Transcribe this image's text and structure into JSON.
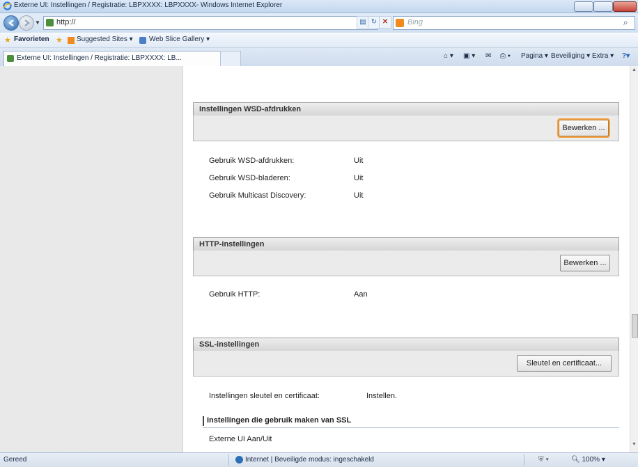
{
  "window": {
    "title": "Externe UI: Instellingen / Registratie: LBPXXXX: LBPXXXX- Windows Internet Explorer"
  },
  "address_bar": {
    "url": "http://",
    "search_placeholder": "Bing"
  },
  "favorites_bar": {
    "favorites_label": "Favorieten",
    "items": [
      "Suggested Sites ▾",
      "Web Slice Gallery ▾"
    ]
  },
  "tab": {
    "label": "Externe UI: Instellingen / Registratie: LBPXXXX: LB..."
  },
  "command_bar": {
    "page": "Pagina ▾",
    "safety": "Beveiliging ▾",
    "tools": "Extra ▾"
  },
  "sections": {
    "wsd": {
      "heading": "Instellingen WSD-afdrukken",
      "button": "Bewerken ...",
      "rows": [
        {
          "label": "Gebruik WSD-afdrukken:",
          "value": "Uit"
        },
        {
          "label": "Gebruik WSD-bladeren:",
          "value": "Uit"
        },
        {
          "label": "Gebruik Multicast Discovery:",
          "value": "Uit"
        }
      ]
    },
    "http": {
      "heading": "HTTP-instellingen",
      "button": "Bewerken ...",
      "rows": [
        {
          "label": "Gebruik HTTP:",
          "value": "Aan"
        }
      ]
    },
    "ssl": {
      "heading": "SSL-instellingen",
      "button": "Sleutel en certificaat...",
      "rows": [
        {
          "label": "Instellingen sleutel en certificaat:",
          "value": "Instellen."
        }
      ],
      "subheading": "Instellingen die gebruik maken van SSL",
      "subrow": "Externe UI Aan/Uit"
    }
  },
  "status_bar": {
    "status": "Gereed",
    "zone": "Internet | Beveiligde modus: ingeschakeld",
    "zoom": "100%"
  },
  "colors": {
    "highlight": "#f0a54a",
    "section_header": "#d6d6d6",
    "chrome": "#dbe8f7"
  }
}
